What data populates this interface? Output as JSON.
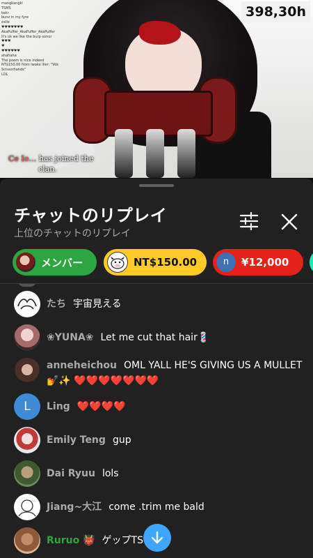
{
  "video": {
    "viewer_count": "398,30h",
    "join_message": {
      "name": "Ce Io…",
      "text_1": "has joined the",
      "text_2": "clan."
    },
    "overlay_chat": [
      {
        "author": "",
        "text": "mangkangki"
      },
      {
        "author": "",
        "text": "TSMS"
      },
      {
        "author": "",
        "text": "kekr"
      },
      {
        "author": "",
        "text": "bunz in my fyre"
      },
      {
        "author": "",
        "text": "exile"
      },
      {
        "author": "",
        "text": "♥♥♥♥♥♥♥"
      },
      {
        "author": "",
        "text": "AkaPuffer_AkaPuffer_AkaPuffer"
      },
      {
        "author": "",
        "text": "It's ok we like the burp sonor"
      },
      {
        "author": "",
        "text": "♥♥♥"
      },
      {
        "author": "",
        "text": "♥"
      },
      {
        "author": "",
        "text": "♥♥♥♥♥♥"
      },
      {
        "author": "",
        "text": "ahahaha"
      },
      {
        "author": "",
        "text": "The poem is nice indeed"
      },
      {
        "author": "",
        "text": "NT$150.00 from Iwake Iller: \"Vox"
      },
      {
        "author": "",
        "text": "Scissorhands\""
      },
      {
        "author": "",
        "text": "LOL"
      }
    ]
  },
  "panel": {
    "title": "チャットのリプレイ",
    "subtitle": "上位のチャットのリプレイ",
    "filter_icon": "sliders-icon",
    "close_icon": "close-icon",
    "chips": [
      {
        "label": "メンバー",
        "color": "#2ba640"
      },
      {
        "label": "NT$150.00",
        "color": "#ffca28"
      },
      {
        "label": "¥12,000",
        "avatar_letter": "n",
        "color": "#e62117"
      },
      {
        "label": "",
        "color": "#1de9b6"
      }
    ],
    "messages": [
      {
        "author": "たち",
        "text": "宇宙見える",
        "member": false,
        "avatar": "sketch"
      },
      {
        "author": "❀YUNA❀",
        "text": "Let me cut that hair💈",
        "member": false,
        "avatar": "photo-pink"
      },
      {
        "author": "anneheichou",
        "text": "OML YALL HE'S GIVING US A MULLET💅✨ ❤️❤️❤️❤️❤️❤️❤️",
        "member": false,
        "avatar": "photo-dark"
      },
      {
        "author": "Ling",
        "text": "❤️❤️❤️❤️",
        "member": false,
        "avatar": "letter",
        "avatar_letter": "L"
      },
      {
        "author": "Emily Teng",
        "text": "gup",
        "member": false,
        "avatar": "photo-anime"
      },
      {
        "author": "Dai Ryuu",
        "text": "lols",
        "member": false,
        "avatar": "photo-green"
      },
      {
        "author": "Jiang~大江",
        "text": "come .trim me bald",
        "member": false,
        "avatar": "sketch-2"
      },
      {
        "author": "Ruruo 👹",
        "text": "ゲップTS",
        "member": true,
        "avatar": "photo-brown"
      }
    ],
    "scroll_down_icon": "arrow-down-icon"
  },
  "colors": {
    "panel_bg": "#212121",
    "member_green": "#2ba640",
    "accent_blue": "#3ea6ff",
    "superchat_yellow": "#ffca28",
    "superchat_red": "#e62117"
  }
}
